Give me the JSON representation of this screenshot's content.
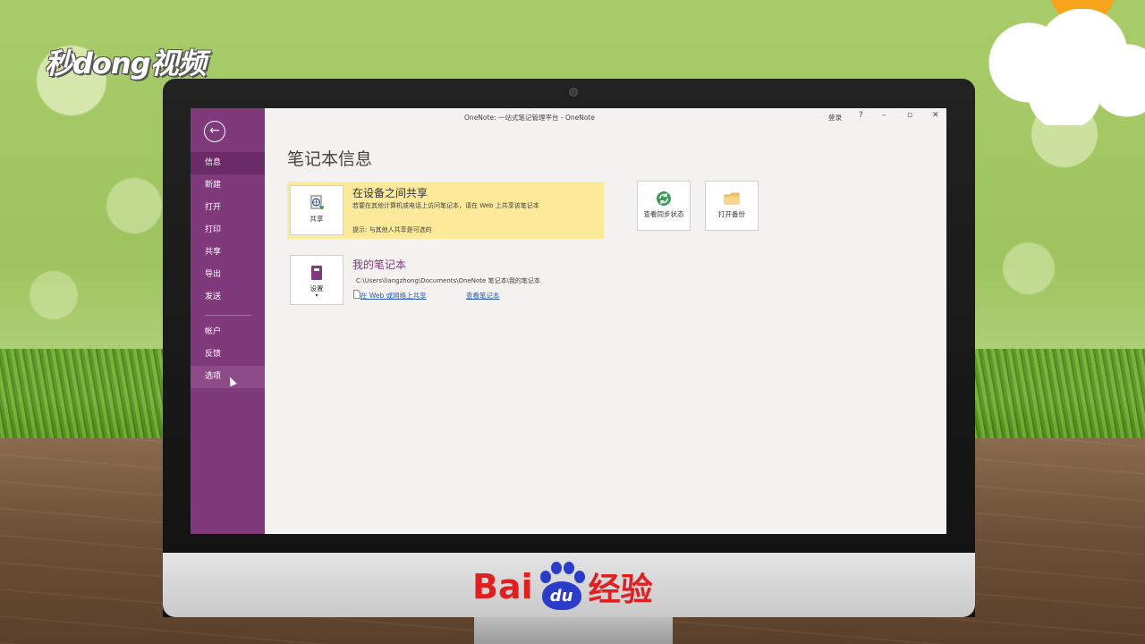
{
  "brand_logo": "秒dong视频",
  "monitor_brand": {
    "bai": "Bai",
    "du": "du",
    "jingyan": "经验"
  },
  "window": {
    "title": "OneNote: 一站式笔记管理平台 - OneNote",
    "login": "登录",
    "help": "?",
    "minimize": "–",
    "restore": "▫",
    "close": "✕"
  },
  "sidebar": {
    "items": [
      {
        "label": "信息"
      },
      {
        "label": "新建"
      },
      {
        "label": "打开"
      },
      {
        "label": "打印"
      },
      {
        "label": "共享"
      },
      {
        "label": "导出"
      },
      {
        "label": "发送"
      },
      {
        "label": "帐户"
      },
      {
        "label": "反馈"
      },
      {
        "label": "选项"
      }
    ]
  },
  "main": {
    "page_title": "笔记本信息",
    "share_card": {
      "tile_label": "共享",
      "title": "在设备之间共享",
      "description": "若要在其他计算机或电话上访问笔记本，请在 Web 上共享该笔记本",
      "hint": "提示: 与其他人共享是可选的"
    },
    "sync_tile": "查看同步状态",
    "backup_tile": "打开备份",
    "notebook_card": {
      "tile_label": "设置",
      "title": "我的笔记本",
      "path": "C:\\Users\\liangzhong\\Documents\\OneNote 笔记本\\我的笔记本",
      "link_share": "在 Web 或网络上共享",
      "link_view": "查看笔记本"
    }
  },
  "colors": {
    "sidebar": "#80397b",
    "highlight_card": "#fde99a",
    "link": "#2a5db0"
  }
}
